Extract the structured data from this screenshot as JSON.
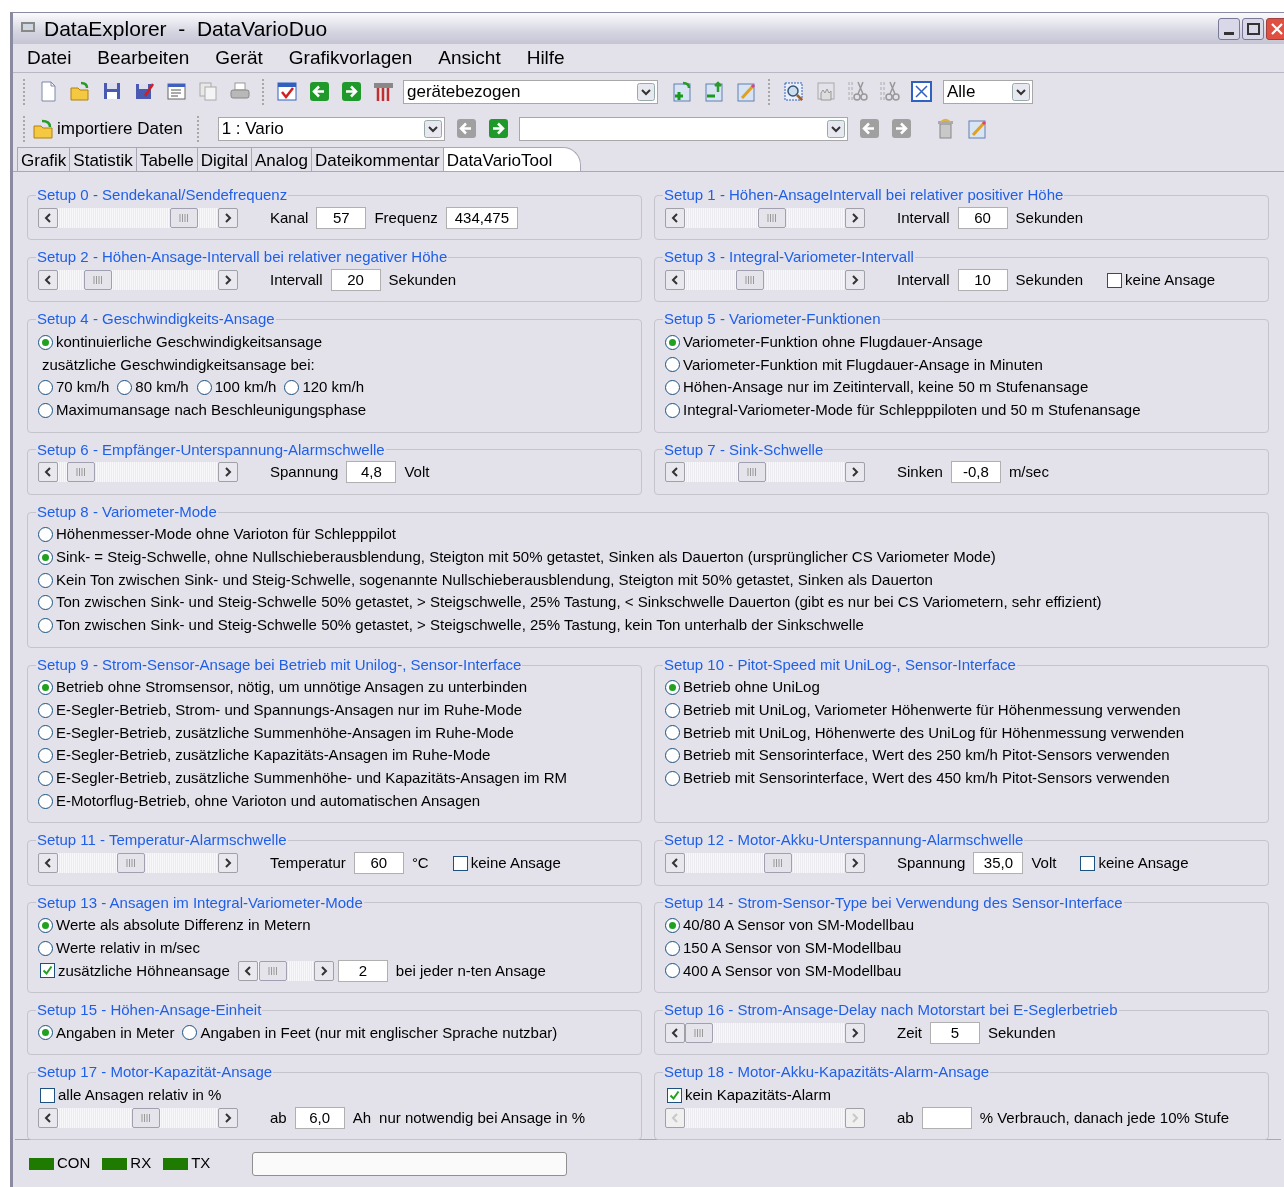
{
  "window": {
    "title": "DataExplorer  -  DataVarioDuo"
  },
  "menu": [
    "Datei",
    "Bearbeiten",
    "Gerät",
    "Grafikvorlagen",
    "Ansicht",
    "Hilfe"
  ],
  "toolbar": {
    "template_combo": "gerätebezogen",
    "filter_combo": "Alle",
    "import_button": "importiere Daten",
    "channel_combo": "1 : Vario"
  },
  "tabs": [
    {
      "label": "Grafik",
      "selected": false
    },
    {
      "label": "Statistik",
      "selected": false
    },
    {
      "label": "Tabelle",
      "selected": false
    },
    {
      "label": "Digital",
      "selected": false
    },
    {
      "label": "Analog",
      "selected": false
    },
    {
      "label": "Dateikommentar",
      "selected": false
    },
    {
      "label": "DataVarioTool",
      "selected": true
    }
  ],
  "setup_rows": [
    {
      "groups": [
        {
          "title": "Setup 0 - Sendekanal/Sendefrequenz",
          "rows": [
            [
              {
                "kind": "scrollbar",
                "level": 0.85
              },
              {
                "kind": "label",
                "text": "Kanal"
              },
              {
                "kind": "field",
                "value": "57"
              },
              {
                "kind": "label",
                "text": "Frequenz"
              },
              {
                "kind": "field",
                "value": "434,475"
              }
            ]
          ]
        },
        {
          "title": "Setup 1 - Höhen-AnsageIntervall bei relativer positiver Höhe",
          "rows": [
            [
              {
                "kind": "scrollbar",
                "level": 0.55
              },
              {
                "kind": "label",
                "text": "Intervall"
              },
              {
                "kind": "field",
                "value": "60"
              },
              {
                "kind": "label",
                "text": "Sekunden"
              }
            ]
          ]
        }
      ]
    },
    {
      "groups": [
        {
          "title": "Setup 2 - Höhen-Ansage-Intervall bei relativer negativer Höhe",
          "rows": [
            [
              {
                "kind": "scrollbar",
                "level": 0.2
              },
              {
                "kind": "label",
                "text": "Intervall"
              },
              {
                "kind": "field",
                "value": "20"
              },
              {
                "kind": "label",
                "text": "Sekunden"
              }
            ]
          ]
        },
        {
          "title": "Setup 3 - Integral-Variometer-Intervall",
          "rows": [
            [
              {
                "kind": "scrollbar",
                "level": 0.39
              },
              {
                "kind": "label",
                "text": "Intervall"
              },
              {
                "kind": "field",
                "value": "10"
              },
              {
                "kind": "label",
                "text": "Sekunden"
              },
              {
                "kind": "checkbox",
                "label": "keine Ansage",
                "checked": false
              }
            ]
          ]
        }
      ]
    },
    {
      "groups": [
        {
          "title": "Setup 4 - Geschwindigkeits-Ansage",
          "rows": [
            [
              {
                "kind": "radio",
                "label": "kontinuierliche Geschwindigkeitsansage",
                "selected": true
              }
            ],
            [
              {
                "kind": "text",
                "text": "zusätzliche Geschwindigkeitsansage bei:"
              }
            ],
            [
              {
                "kind": "radio",
                "label": "70 km/h",
                "selected": false
              },
              {
                "kind": "radio",
                "label": "80 km/h",
                "selected": false
              },
              {
                "kind": "radio",
                "label": "100 km/h",
                "selected": false
              },
              {
                "kind": "radio",
                "label": "120 km/h",
                "selected": false
              }
            ],
            [
              {
                "kind": "radio",
                "label": "Maximumansage nach Beschleunigungsphase",
                "selected": false
              }
            ]
          ]
        },
        {
          "title": "Setup 5 - Variometer-Funktionen",
          "rows": [
            [
              {
                "kind": "radio",
                "label": "Variometer-Funktion ohne Flugdauer-Ansage",
                "selected": true
              }
            ],
            [
              {
                "kind": "radio",
                "label": "Variometer-Funktion mit Flugdauer-Ansage in Minuten",
                "selected": false
              }
            ],
            [
              {
                "kind": "radio",
                "label": "Höhen-Ansage nur im Zeitintervall, keine 50 m Stufenansage",
                "selected": false
              }
            ],
            [
              {
                "kind": "radio",
                "label": "Integral-Variometer-Mode für Schlepppiloten und 50 m Stufenansage",
                "selected": false
              }
            ]
          ]
        }
      ]
    },
    {
      "groups": [
        {
          "title": "Setup 6 - Empfänger-Unterspannung-Alarmschwelle",
          "rows": [
            [
              {
                "kind": "scrollbar",
                "level": 0.07
              },
              {
                "kind": "label",
                "text": "Spannung"
              },
              {
                "kind": "field",
                "value": "4,8"
              },
              {
                "kind": "label",
                "text": "Volt"
              }
            ]
          ]
        },
        {
          "title": "Setup 7 - Sink-Schwelle",
          "rows": [
            [
              {
                "kind": "scrollbar",
                "level": 0.4
              },
              {
                "kind": "label",
                "text": "Sinken"
              },
              {
                "kind": "field",
                "value": "-0,8"
              },
              {
                "kind": "label",
                "text": "m/sec"
              }
            ]
          ]
        }
      ]
    },
    {
      "groups": [
        {
          "title": "Setup 8 - Variometer-Mode",
          "rows": [
            [
              {
                "kind": "radio",
                "label": "Höhenmesser-Mode ohne Varioton für Schlepppilot",
                "selected": false
              }
            ],
            [
              {
                "kind": "radio",
                "label": "Sink- = Steig-Schwelle, ohne Nullschieberausblendung, Steigton mit 50% getastet, Sinken als Dauerton (ursprünglicher CS Variometer Mode)",
                "selected": true
              }
            ],
            [
              {
                "kind": "radio",
                "label": "Kein Ton zwischen Sink- und Steig-Schwelle, sogenannte Nullschieberausblendung, Steigton mit 50% getastet, Sinken als Dauerton",
                "selected": false
              }
            ],
            [
              {
                "kind": "radio",
                "label": "Ton zwischen Sink- und Steig-Schwelle 50% getastet,  > Steigschwelle, 25% Tastung, < Sinkschwelle Dauerton (gibt es nur bei CS Variometern, sehr effizient)",
                "selected": false
              }
            ],
            [
              {
                "kind": "radio",
                "label": "Ton zwischen Sink- und Steig-Schwelle 50% getastet,  > Steigschwelle, 25% Tastung, kein Ton unterhalb der Sinkschwelle",
                "selected": false
              }
            ]
          ]
        }
      ]
    },
    {
      "groups": [
        {
          "title": "Setup 9 - Strom-Sensor-Ansage bei Betrieb mit Unilog-, Sensor-Interface",
          "rows": [
            [
              {
                "kind": "radio",
                "label": "Betrieb ohne Stromsensor, nötig, um unnötige Ansagen zu unterbinden",
                "selected": true
              }
            ],
            [
              {
                "kind": "radio",
                "label": "E-Segler-Betrieb, Strom- und Spannungs-Ansagen nur im Ruhe-Mode",
                "selected": false
              }
            ],
            [
              {
                "kind": "radio",
                "label": "E-Segler-Betrieb, zusätzliche Summenhöhe-Ansagen im Ruhe-Mode",
                "selected": false
              }
            ],
            [
              {
                "kind": "radio",
                "label": "E-Segler-Betrieb, zusätzliche Kapazitäts-Ansagen im Ruhe-Mode",
                "selected": false
              }
            ],
            [
              {
                "kind": "radio",
                "label": "E-Segler-Betrieb, zusätzliche Summenhöhe- und Kapazitäts-Ansagen im RM",
                "selected": false
              }
            ],
            [
              {
                "kind": "radio",
                "label": "E-Motorflug-Betrieb, ohne Varioton und automatischen Ansagen",
                "selected": false
              }
            ]
          ]
        },
        {
          "title": "Setup 10 - Pitot-Speed mit UniLog-, Sensor-Interface",
          "rows": [
            [
              {
                "kind": "radio",
                "label": "Betrieb ohne UniLog",
                "selected": true
              }
            ],
            [
              {
                "kind": "radio",
                "label": "Betrieb mit UniLog, Variometer Höhenwerte für Höhenmessung verwenden",
                "selected": false
              }
            ],
            [
              {
                "kind": "radio",
                "label": "Betrieb mit UniLog, Höhenwerte des UniLog für Höhenmessung verwenden",
                "selected": false
              }
            ],
            [
              {
                "kind": "radio",
                "label": "Betrieb mit Sensorinterface, Wert des 250 km/h Pitot-Sensors verwenden",
                "selected": false
              }
            ],
            [
              {
                "kind": "radio",
                "label": "Betrieb mit Sensorinterface, Wert des 450 km/h Pitot-Sensors verwenden",
                "selected": false
              }
            ]
          ]
        }
      ]
    },
    {
      "groups": [
        {
          "title": "Setup 11 - Temperatur-Alarmschwelle",
          "rows": [
            [
              {
                "kind": "scrollbar",
                "level": 0.45
              },
              {
                "kind": "label",
                "text": "Temperatur"
              },
              {
                "kind": "field",
                "value": "60"
              },
              {
                "kind": "label",
                "text": "°C"
              },
              {
                "kind": "checkbox",
                "label": "keine Ansage",
                "checked": false
              }
            ]
          ]
        },
        {
          "title": "Setup 12 - Motor-Akku-Unterspannung-Alarmschwelle",
          "rows": [
            [
              {
                "kind": "scrollbar",
                "level": 0.6
              },
              {
                "kind": "label",
                "text": "Spannung"
              },
              {
                "kind": "field",
                "value": "35,0"
              },
              {
                "kind": "label",
                "text": "Volt"
              },
              {
                "kind": "checkbox",
                "label": "keine Ansage",
                "checked": false
              }
            ]
          ]
        }
      ]
    },
    {
      "groups": [
        {
          "title": "Setup 13 - Ansagen im Integral-Variometer-Mode",
          "rows": [
            [
              {
                "kind": "radio",
                "label": "Werte als absolute Differenz in Metern",
                "selected": true
              }
            ],
            [
              {
                "kind": "radio",
                "label": "Werte relativ in m/sec",
                "selected": false
              }
            ],
            [
              {
                "kind": "checkbox",
                "label": "zusätzliche Höhneansage",
                "checked": true
              },
              {
                "kind": "scrollbar",
                "level": 0.05,
                "compact": true
              },
              {
                "kind": "field",
                "value": "2"
              },
              {
                "kind": "label",
                "text": "bei jeder n-ten Ansage"
              }
            ]
          ]
        },
        {
          "title": "Setup 14 - Strom-Sensor-Type bei Verwendung des Sensor-Interface",
          "rows": [
            [
              {
                "kind": "radio",
                "label": "40/80 A Sensor von SM-Modellbau",
                "selected": true
              }
            ],
            [
              {
                "kind": "radio",
                "label": "150 A Sensor von SM-Modellbau",
                "selected": false
              }
            ],
            [
              {
                "kind": "radio",
                "label": "400 A Sensor von SM-Modellbau",
                "selected": false
              }
            ]
          ]
        }
      ]
    },
    {
      "groups": [
        {
          "title": "Setup 15 - Höhen-Ansage-Einheit",
          "rows": [
            [
              {
                "kind": "radio",
                "label": "Angaben in Meter",
                "selected": true
              },
              {
                "kind": "radio",
                "label": "Angaben in Feet (nur mit englischer Sprache nutzbar)",
                "selected": false
              }
            ]
          ]
        },
        {
          "title": "Setup 16 - Strom-Ansage-Delay nach Motorstart bei E-Seglerbetrieb",
          "rows": [
            [
              {
                "kind": "scrollbar",
                "level": 0
              },
              {
                "kind": "label",
                "text": "Zeit"
              },
              {
                "kind": "field",
                "value": "5"
              },
              {
                "kind": "label",
                "text": "Sekunden"
              }
            ]
          ]
        }
      ]
    },
    {
      "groups": [
        {
          "title": "Setup 17 - Motor-Kapazität-Ansage",
          "rows": [
            [
              {
                "kind": "checkbox",
                "label": "alle Ansagen relativ in %",
                "checked": false
              }
            ],
            [
              {
                "kind": "scrollbar",
                "level": 0.56
              },
              {
                "kind": "label",
                "text": "ab"
              },
              {
                "kind": "field",
                "value": "6,0"
              },
              {
                "kind": "label",
                "text": "Ah"
              },
              {
                "kind": "label",
                "text": "nur notwendig bei Ansage in %"
              }
            ]
          ]
        },
        {
          "title": "Setup 18 - Motor-Akku-Kapazitäts-Alarm-Ansage",
          "rows": [
            [
              {
                "kind": "checkbox",
                "label": "kein Kapazitäts-Alarm",
                "checked": true
              }
            ],
            [
              {
                "kind": "scrollbar",
                "disabled": true
              },
              {
                "kind": "label",
                "text": "ab"
              },
              {
                "kind": "field"
              },
              {
                "kind": "label",
                "text": "% Verbrauch, danach jede 10% Stufe"
              }
            ]
          ]
        }
      ]
    }
  ],
  "status_bar": {
    "indicators": [
      {
        "label": "CON"
      },
      {
        "label": "RX"
      },
      {
        "label": "TX"
      }
    ]
  }
}
